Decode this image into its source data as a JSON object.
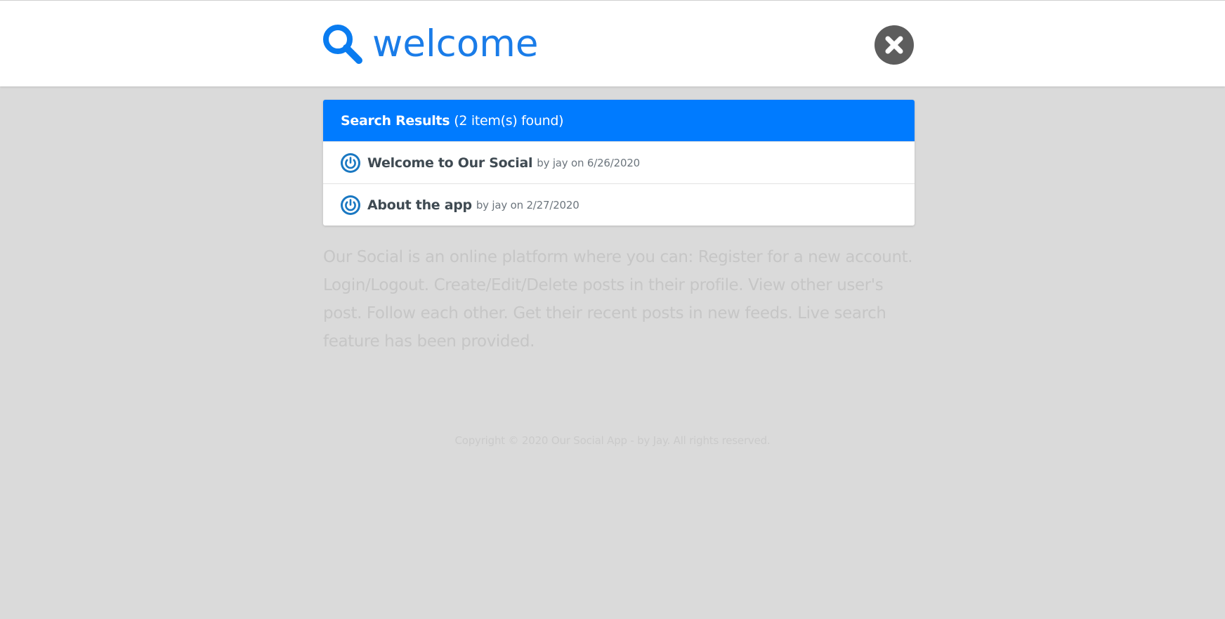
{
  "search": {
    "value": "welcome",
    "accent_color": "#007bff",
    "icon": "search-icon",
    "close_icon": "close-icon"
  },
  "results": {
    "header_strong": "Search Results",
    "header_count": "(2 item(s) found)",
    "items": [
      {
        "title": "Welcome to Our Social",
        "meta": "by jay on 6/26/2020",
        "avatar_icon": "power-avatar-icon"
      },
      {
        "title": "About the app",
        "meta": "by jay on 2/27/2020",
        "avatar_icon": "power-avatar-icon"
      }
    ]
  },
  "about_text": "Our Social is an online platform where you can: Register for a new account. Login/Logout. Create/Edit/Delete posts in their profile. View other user's post. Follow each other. Get their recent posts in new feeds. Live search feature has been provided.",
  "footer": {
    "text": "Copyright © 2020 Our Social App - by Jay. All rights reserved."
  },
  "colors": {
    "overlay_bg": "#dadada",
    "header_bg": "#007bff",
    "close_bg": "#5d5d5d"
  }
}
